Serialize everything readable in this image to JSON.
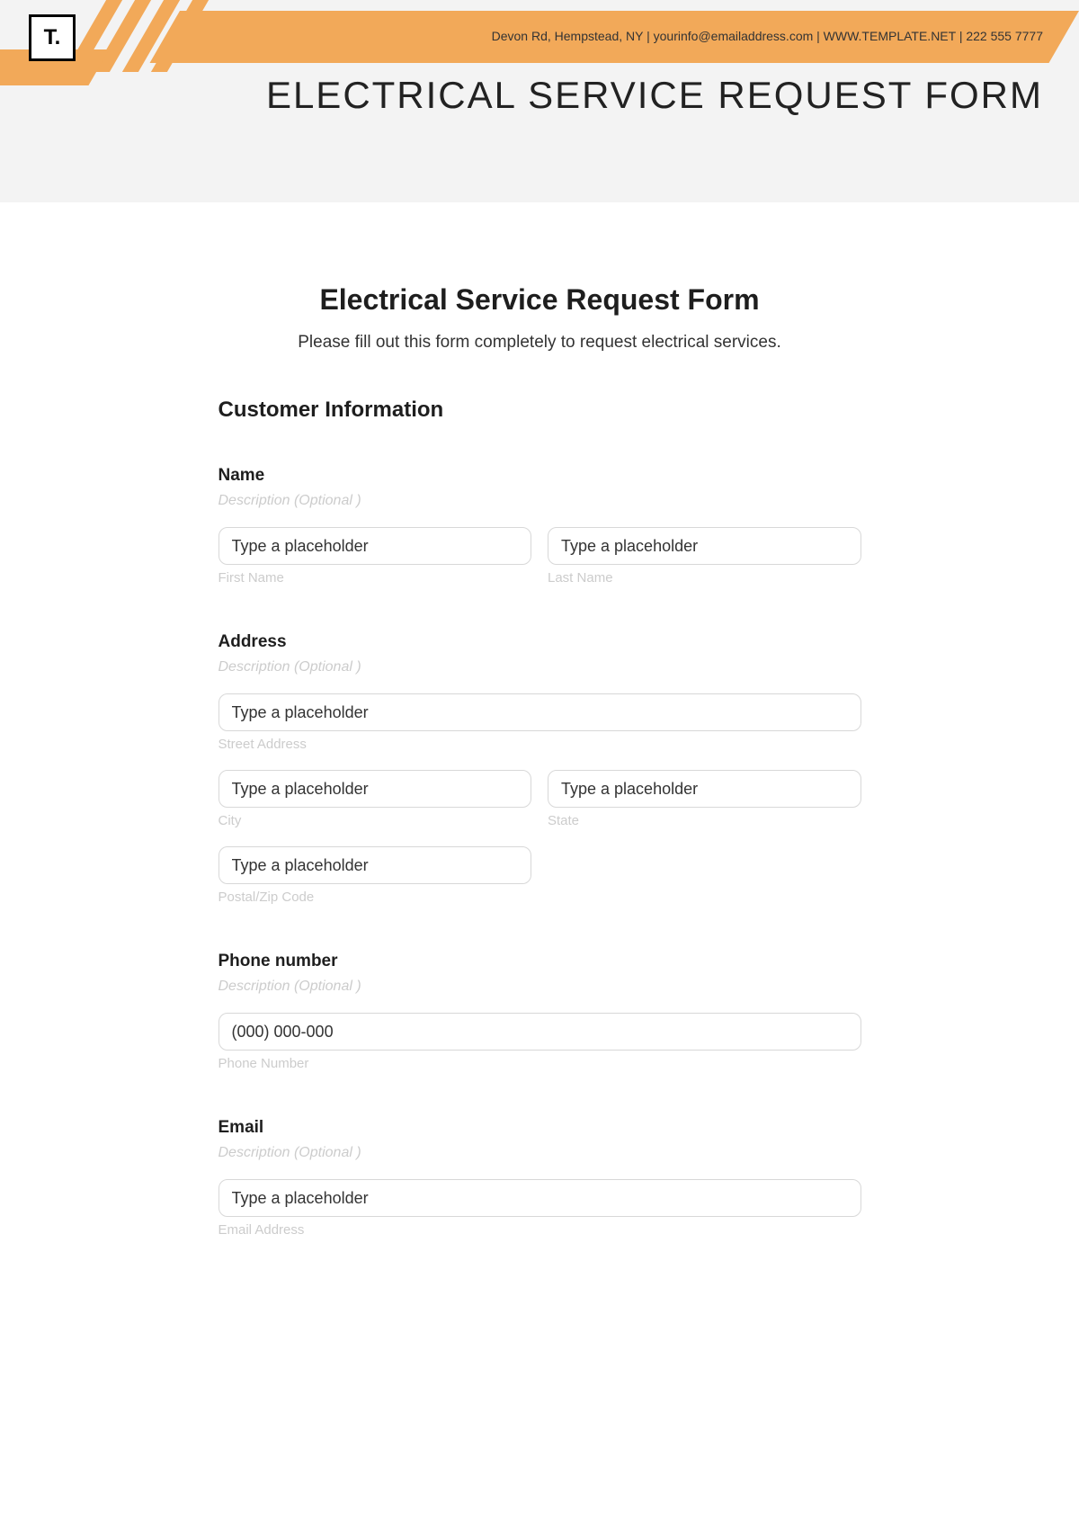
{
  "header": {
    "logo_text": "T.",
    "info_line": "Devon Rd, Hempstead, NY | yourinfo@emailaddress.com | WWW.TEMPLATE.NET | 222 555 7777",
    "title": "ELECTRICAL SERVICE REQUEST FORM"
  },
  "form": {
    "title": "Electrical Service Request Form",
    "subtitle": "Please fill out this form completely to request electrical services.",
    "section_title": "Customer Information",
    "desc_optional": "Description (Optional )",
    "generic_placeholder": "Type a placeholder",
    "name": {
      "label": "Name",
      "first_sub": "First Name",
      "last_sub": "Last Name"
    },
    "address": {
      "label": "Address",
      "street_sub": "Street Address",
      "city_sub": "City",
      "state_sub": "State",
      "zip_sub": "Postal/Zip Code"
    },
    "phone": {
      "label": "Phone number",
      "placeholder": "(000) 000-000",
      "sub": "Phone Number"
    },
    "email": {
      "label": "Email",
      "sub": "Email Address"
    }
  }
}
